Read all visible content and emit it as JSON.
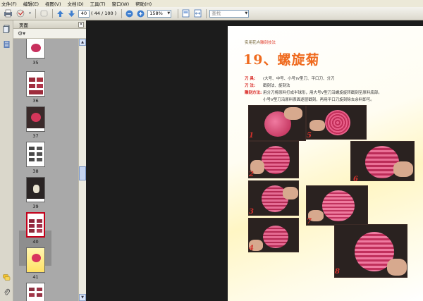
{
  "menu": [
    "文件(F)",
    "编辑(E)",
    "视图(V)",
    "文档(D)",
    "工具(T)",
    "窗口(W)",
    "帮助(H)"
  ],
  "toolbar": {
    "page_current": "40",
    "page_count": "( 44 / 100 )",
    "zoom": "158%",
    "find_placeholder": "查找"
  },
  "panel": {
    "title": "页面"
  },
  "thumbnails": [
    {
      "label": "35"
    },
    {
      "label": "36"
    },
    {
      "label": "37"
    },
    {
      "label": "38"
    },
    {
      "label": "39"
    },
    {
      "label": "40"
    },
    {
      "label": "41"
    }
  ],
  "page": {
    "header_prefix": "实用花卉",
    "header_highlight": "雕刻技法",
    "title": "19、螺旋菊",
    "tools_key": "刀    具:",
    "tools_val": "(大号、中号、小号)V型刀、平口刀、分刀",
    "method_key": "刀    法:",
    "method_val": "戳刻法、旋刻法",
    "process_key": "雕刻方法:",
    "process_val1": "用分刀将原料打成半球形，用大号V型刀沿螺旋旋转戳刻至原料底部。",
    "process_val2": "小号V型刀沿原料表面逐层戳刻，再用平口刀旋刻除去余料即可。",
    "steps": [
      "1",
      "2",
      "3",
      "4",
      "5",
      "6",
      "7",
      "8"
    ],
    "page_number": "40"
  },
  "colors": {
    "title": "#ef6a1e",
    "label_red": "#d8231f",
    "viewport_bg": "#1c1c1c",
    "radish": "#d2386a"
  }
}
